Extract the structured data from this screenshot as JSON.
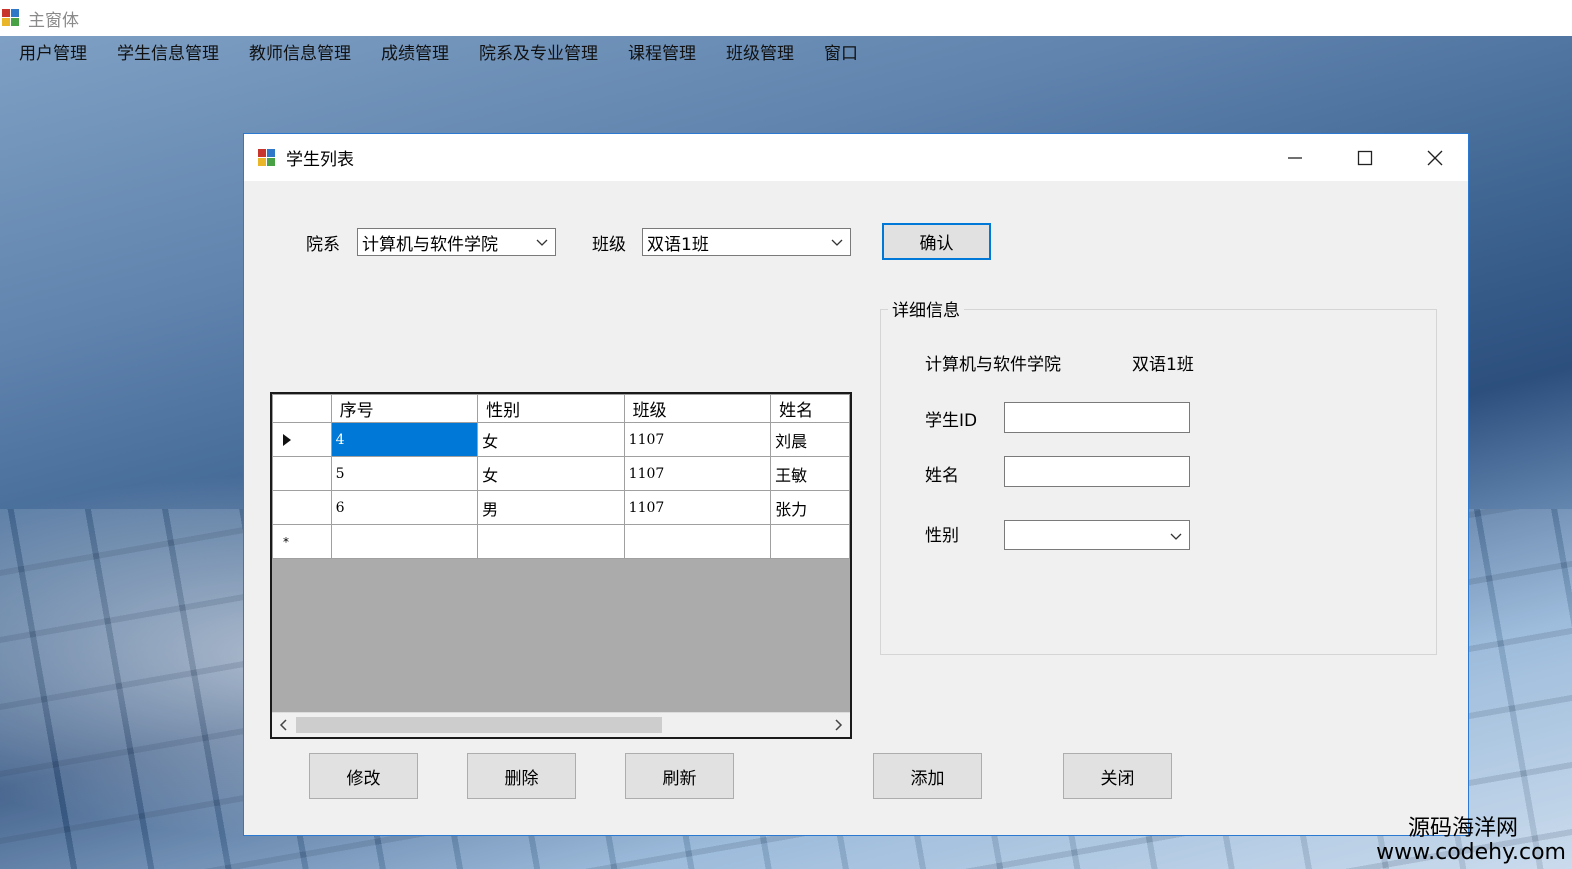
{
  "main_window": {
    "title": "主窗体"
  },
  "menu": [
    "用户管理",
    "学生信息管理",
    "教师信息管理",
    "成绩管理",
    "院系及专业管理",
    "课程管理",
    "班级管理",
    "窗口"
  ],
  "dialog": {
    "title": "学生列表",
    "filter": {
      "department_label": "院系",
      "department_value": "计算机与软件学院",
      "class_label": "班级",
      "class_value": "双语1班",
      "confirm_button": "确认"
    },
    "grid": {
      "columns": [
        "序号",
        "性别",
        "班级",
        "姓名"
      ],
      "rows": [
        [
          "4",
          "女",
          "1107",
          "刘晨"
        ],
        [
          "5",
          "女",
          "1107",
          "王敏"
        ],
        [
          "6",
          "男",
          "1107",
          "张力"
        ]
      ],
      "new_row_marker": "*"
    },
    "details": {
      "group_title": "详细信息",
      "department": "计算机与软件学院",
      "class": "双语1班",
      "student_id_label": "学生ID",
      "student_id_value": "",
      "name_label": "姓名",
      "name_value": "",
      "gender_label": "性别",
      "gender_value": ""
    },
    "buttons": {
      "modify": "修改",
      "delete": "删除",
      "refresh": "刷新",
      "add": "添加",
      "close": "关闭"
    }
  },
  "watermark": {
    "line1": "源码海洋网",
    "line2": "www.codehy.com"
  }
}
